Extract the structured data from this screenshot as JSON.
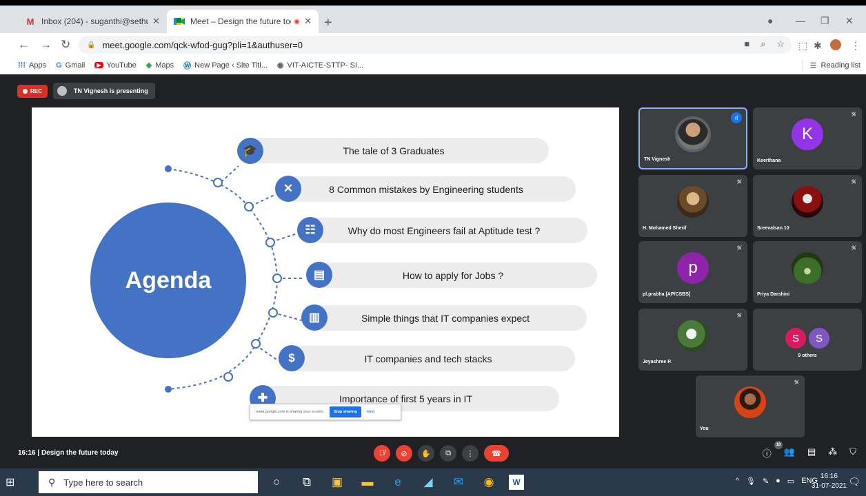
{
  "browser": {
    "tabs": [
      {
        "title": "Inbox (204) - suganthi@sethu.ac",
        "icon": "gmail-icon"
      },
      {
        "title": "Meet – Design the future toc",
        "icon": "meet-icon"
      }
    ],
    "url": "meet.google.com/qck-wfod-gug?pli=1&authuser=0",
    "bookmarks": [
      "Apps",
      "Gmail",
      "YouTube",
      "Maps",
      "New Page ‹ Site Titl...",
      "VIT-AICTE-STTP- SI..."
    ],
    "reading_list": "Reading list"
  },
  "meet": {
    "rec_label": "REC",
    "presenting_label": "TN Vignesh is presenting",
    "slide": {
      "title": "Agenda",
      "items": [
        "The tale of 3 Graduates",
        "8 Common mistakes by Engineering students",
        "Why do most Engineers fail at Aptitude test ?",
        "How to apply for Jobs ?",
        "Simple things that IT companies expect",
        "IT companies and tech stacks",
        "Importance of first 5 years in IT"
      ]
    },
    "sharebar": {
      "text": "meet.google.com is sharing your screen.",
      "stop": "Stop sharing",
      "hide": "Hide"
    },
    "participants": [
      {
        "name": "TN Vignesh",
        "avatar": "photo",
        "speaking": true
      },
      {
        "name": "Keerthana",
        "avatar": "letter",
        "letter": "K",
        "color": "#9334e6"
      },
      {
        "name": "H. Mohamed Sherif",
        "avatar": "photo"
      },
      {
        "name": "Sreevalsan 10",
        "avatar": "photo"
      },
      {
        "name": "pl.prabha [AP/CSBS]",
        "avatar": "letter",
        "letter": "p",
        "color": "#8e24aa"
      },
      {
        "name": "Priya Darshini",
        "avatar": "photo"
      },
      {
        "name": "Jeyashree P.",
        "avatar": "photo"
      },
      {
        "name": "9 others",
        "avatar": "group",
        "letters": [
          "S",
          "S"
        ]
      },
      {
        "name": "You",
        "avatar": "photo"
      }
    ],
    "time": "16:16",
    "meeting_name": "Design the future today",
    "people_count": "18"
  },
  "taskbar": {
    "search_placeholder": "Type here to search",
    "lang": "ENG",
    "time": "16:16",
    "date": "31-07-2021"
  }
}
